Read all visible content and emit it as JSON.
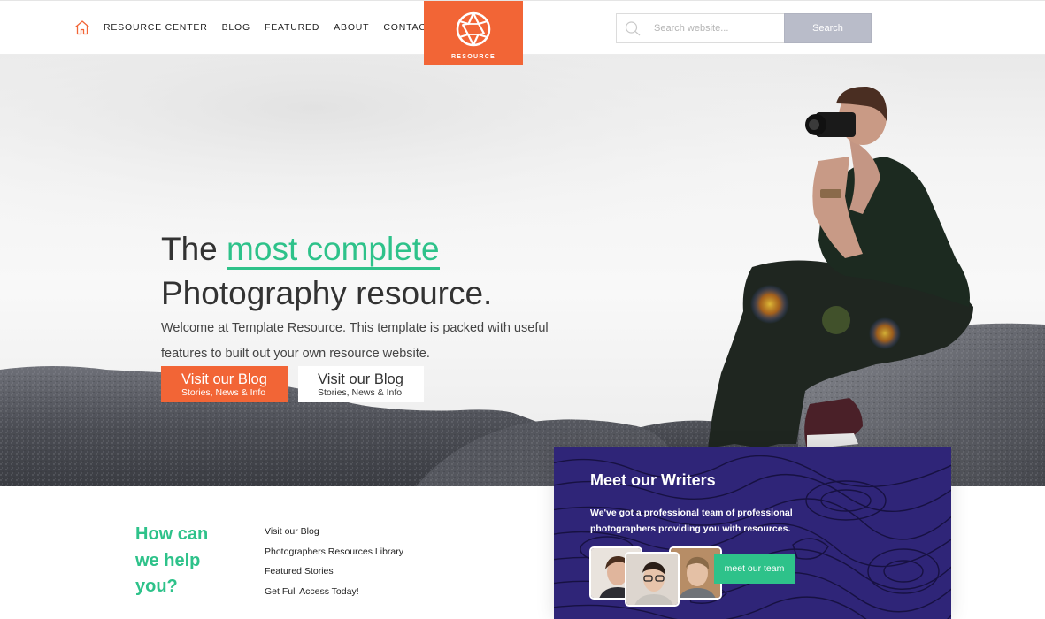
{
  "header": {
    "nav": [
      "RESOURCE CENTER",
      "BLOG",
      "FEATURED",
      "ABOUT",
      "CONTACT"
    ],
    "logo_text": "RESOURCE",
    "search_placeholder": "Search website...",
    "search_button": "Search"
  },
  "hero": {
    "headline_pre": "The ",
    "headline_accent": "most complete",
    "headline_line2": "Photography resource.",
    "intro": "Welcome at Template Resource. This template is packed with useful features to built out your own resource website.",
    "btn_primary_title": "Visit our Blog",
    "btn_primary_sub": "Stories, News & Info",
    "btn_secondary_title": "Visit our Blog",
    "btn_secondary_sub": "Stories, News & Info"
  },
  "help": {
    "title": "How can we help you?",
    "links": [
      "Visit our Blog",
      "Photographers Resources Library",
      "Featured Stories",
      "Get Full Access Today!"
    ]
  },
  "writers": {
    "title": "Meet our Writers",
    "text": "We've got a professional team of professional photographers providing you with resources.",
    "button": "meet our team"
  },
  "colors": {
    "accent_orange": "#f26536",
    "accent_green": "#2ec28a",
    "card_purple": "#2f2578",
    "search_button": "#b9bcc9"
  },
  "icons": [
    "home-icon",
    "aperture-icon",
    "search-icon"
  ]
}
